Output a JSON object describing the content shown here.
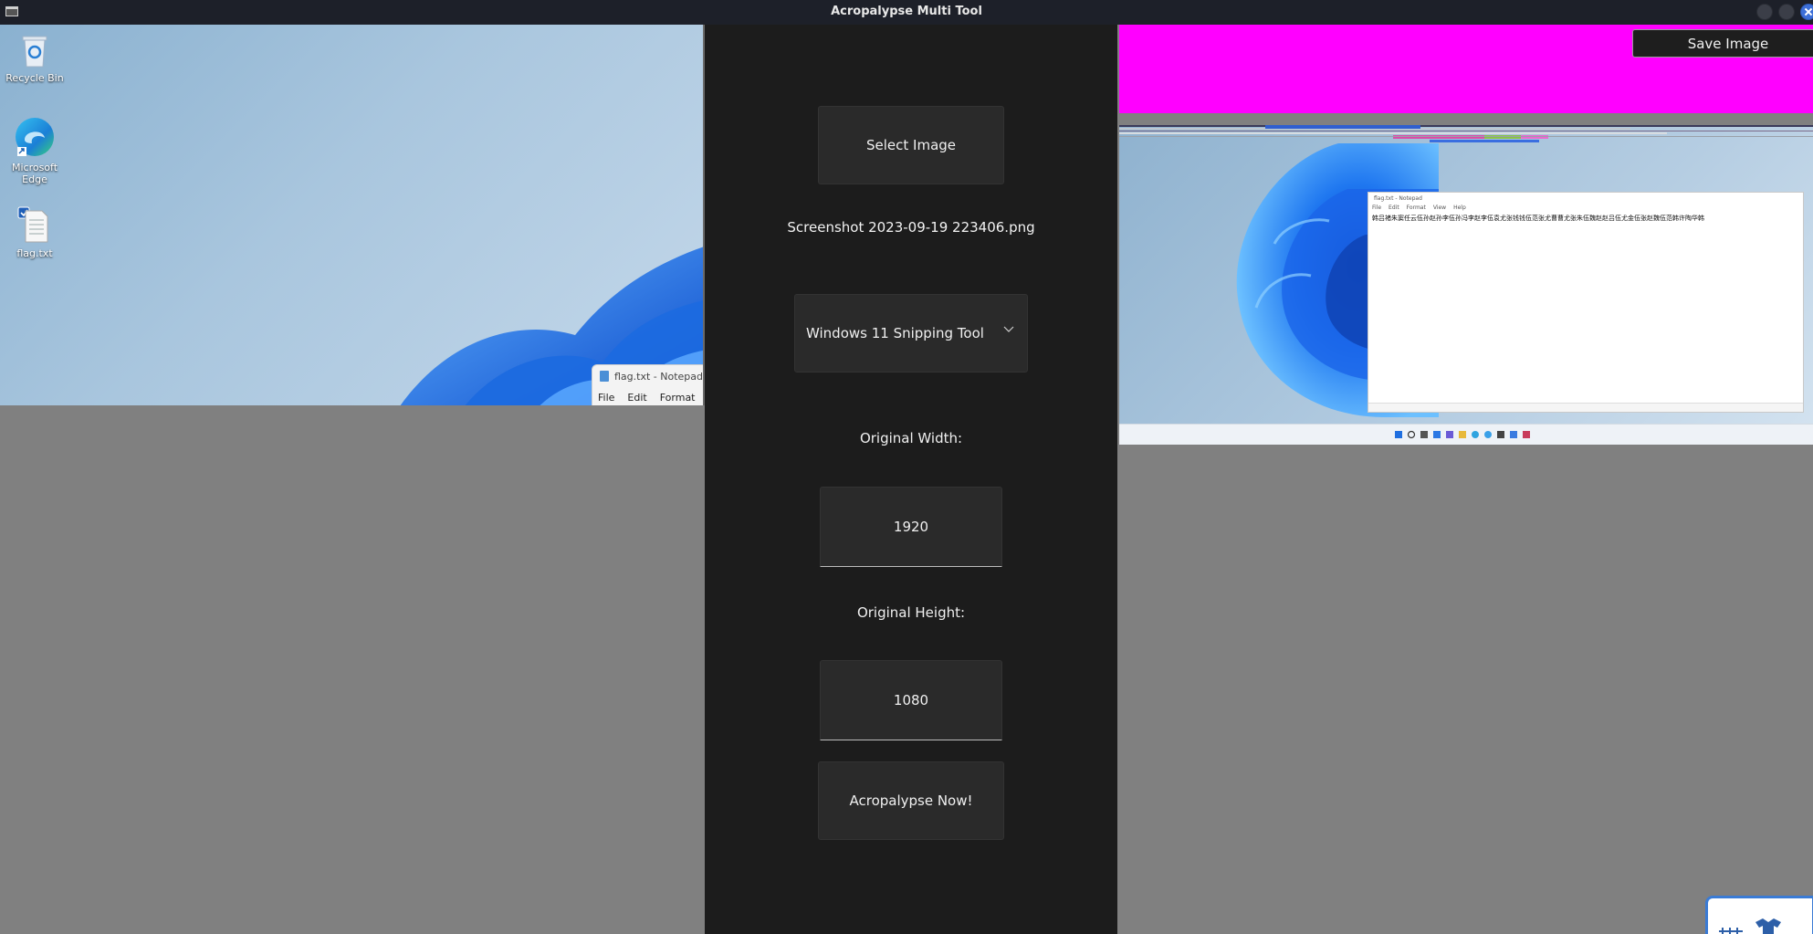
{
  "window": {
    "title": "Acropalypse Multi Tool"
  },
  "left_preview": {
    "desktop_icons": [
      {
        "label": "Recycle Bin",
        "icon": "recycle-bin-icon"
      },
      {
        "label": "Microsoft Edge",
        "icon": "edge-icon"
      },
      {
        "label": "flag.txt",
        "icon": "text-file-icon"
      }
    ],
    "notepad": {
      "title": "flag.txt - Notepad",
      "menu": [
        "File",
        "Edit",
        "Format"
      ]
    }
  },
  "controls": {
    "select_image_label": "Select Image",
    "filename": "Screenshot 2023-09-19 223406.png",
    "device_selected": "Windows 11 Snipping Tool",
    "width_label": "Original Width:",
    "width_value": "1920",
    "height_label": "Original Height:",
    "height_value": "1080",
    "run_label": "Acropalypse Now!"
  },
  "right_preview": {
    "save_image_label": "Save Image",
    "notepad": {
      "title": "flag.txt - Notepad",
      "menu": [
        "File",
        "Edit",
        "Format",
        "View",
        "Help"
      ],
      "text": "韩吕褚朱窦任云伍孙赵孙李伍孙冯李赵李伍袁尤张钱钱伍范张尤曹曹尤张朱伍魏赵赵吕伍尤金伍张赵魏伍范韩许陶华韩"
    }
  },
  "colors": {
    "titlebar_bg": "#1d2029",
    "center_bg": "#1c1c1c",
    "button_bg": "#2a2a2a",
    "magenta": "#ff00ff",
    "background_gray": "#808080"
  }
}
